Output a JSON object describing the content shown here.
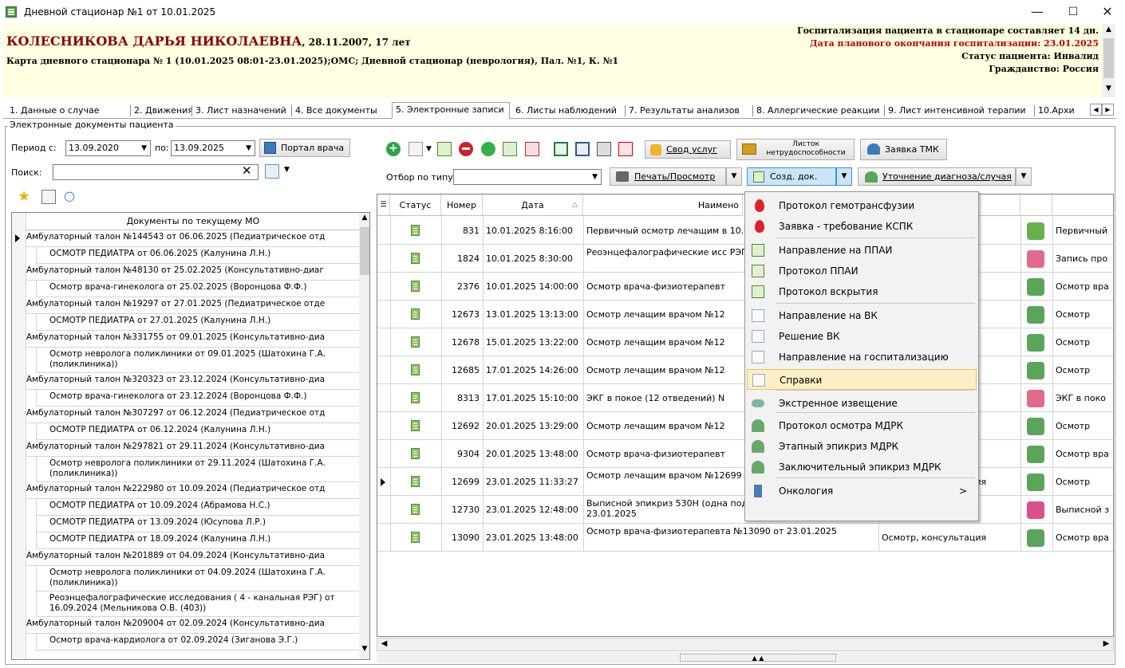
{
  "window": {
    "title": "Дневной стационар №1 от 10.01.2025",
    "minimize": "—",
    "maximize": "☐",
    "close": "✕"
  },
  "patient": {
    "name": "КОЛЕСНИКОВА ДАРЬЯ НИКОЛАЕВНА",
    "dob": ", 28.11.2007, 17 лет",
    "card": "Карта дневного стационара  № 1 (10.01.2025 08:01-23.01.2025);ОМС; Дневной стационар (неврология), Пал. №1, К. №1",
    "info1": "Госпитализация пациента в стационаре составляет 14 дн.",
    "info2": "Дата планового окончания госпитализации: 23.01.2025",
    "info3": "Статус пациента: Инвалид",
    "info4": "Гражданство: Россия"
  },
  "tabs": [
    "1. Данные о случае",
    "2. Движения",
    "3. Лист назначений",
    "4. Все документы",
    "5. Электронные записи",
    "6. Листы наблюдений",
    "7. Результаты анализов",
    "8. Аллергические реакции",
    "9. Лист интенсивной терапии",
    "10.Архи"
  ],
  "group_label": "Электронные документы пациента",
  "left": {
    "period_from_label": "Период с:",
    "period_from": "13.09.2020",
    "period_to_label": "по:",
    "period_to": "13.09.2025",
    "portal_button": "Портал врача",
    "search_label": "Поиск:",
    "search_value": "",
    "clear": "✕",
    "header": "Документы по текущему МО",
    "rows": [
      {
        "t": "Амбулаторный талон №144543 от 06.06.2025 (Педиатрическое отд",
        "c": false,
        "h": 1,
        "cur": true
      },
      {
        "t": "ОСМОТР ПЕДИАТРА от 06.06.2025 (Калунина Л.Н.)",
        "c": true,
        "h": 1
      },
      {
        "t": "Амбулаторный талон №48130 от 25.02.2025 (Консультативно-диаг",
        "c": false,
        "h": 1
      },
      {
        "t": "Осмотр врача-гинеколога от 25.02.2025 (Воронцова Ф.Ф.)",
        "c": true,
        "h": 1
      },
      {
        "t": "Амбулаторный талон №19297 от 27.01.2025 (Педиатрическое отде",
        "c": false,
        "h": 1
      },
      {
        "t": "ОСМОТР ПЕДИАТРА от 27.01.2025 (Калунина Л.Н.)",
        "c": true,
        "h": 1
      },
      {
        "t": "Амбулаторный талон №331755 от 09.01.2025 (Консультативно-диа",
        "c": false,
        "h": 1
      },
      {
        "t": "Осмотр невролога поликлиники от 09.01.2025 (Шатохина Г.А. (поликлиника))",
        "c": true,
        "h": 2
      },
      {
        "t": "Амбулаторный талон №320323 от 23.12.2024 (Консультативно-диа",
        "c": false,
        "h": 1
      },
      {
        "t": "Осмотр врача-гинеколога от 23.12.2024 (Воронцова Ф.Ф.)",
        "c": true,
        "h": 1
      },
      {
        "t": "Амбулаторный талон №307297 от 06.12.2024 (Педиатрическое отд",
        "c": false,
        "h": 1
      },
      {
        "t": "ОСМОТР ПЕДИАТРА от 06.12.2024 (Калунина Л.Н.)",
        "c": true,
        "h": 1
      },
      {
        "t": "Амбулаторный талон №297821 от 29.11.2024 (Консультативно-диа",
        "c": false,
        "h": 1
      },
      {
        "t": "Осмотр невролога поликлиники от 29.11.2024 (Шатохина Г.А. (поликлиника))",
        "c": true,
        "h": 2
      },
      {
        "t": "Амбулаторный талон №222980 от 10.09.2024 (Педиатрическое отд",
        "c": false,
        "h": 1
      },
      {
        "t": "ОСМОТР ПЕДИАТРА от 10.09.2024 (Абрамова Н.С.)",
        "c": true,
        "h": 1
      },
      {
        "t": "ОСМОТР ПЕДИАТРА от 13.09.2024 (Юсупова Л.Р.)",
        "c": true,
        "h": 1
      },
      {
        "t": "ОСМОТР ПЕДИАТРА от 18.09.2024 (Калунина Л.Н.)",
        "c": true,
        "h": 1
      },
      {
        "t": "Амбулаторный талон №201889 от 04.09.2024 (Консультативно-диа",
        "c": false,
        "h": 1
      },
      {
        "t": "Осмотр невролога поликлиники от 04.09.2024 (Шатохина Г.А. (поликлиника))",
        "c": true,
        "h": 2
      },
      {
        "t": "Реоэнцефалографические исследования ( 4 - канальная РЭГ) от 16.09.2024 (Мельникова О.В. (403))",
        "c": true,
        "h": 2
      },
      {
        "t": "Амбулаторный талон №209004 от 02.09.2024 (Консультативно-диа",
        "c": false,
        "h": 1
      },
      {
        "t": "Осмотр врача-кардиолога от 02.09.2024 (Зиганова Э.Г.)",
        "c": true,
        "h": 1
      }
    ]
  },
  "toolbar": {
    "svod": "Свод услуг",
    "listok_top": "Листок",
    "listok_bottom": "нетрудоспособности",
    "tmk": "Заявка ТМК",
    "filter_label": "Отбор по типу:",
    "filter_value": "",
    "print": "Печать/Просмотр",
    "create": "Созд. док.",
    "refine": "Уточнение диагноза/случая"
  },
  "grid": {
    "headers": [
      "Статус",
      "Номер",
      "Дата",
      "Наимено"
    ],
    "rows": [
      {
        "num": "831",
        "date": "10.01.2025 8:16:00",
        "name": "Первичный осмотр лечащим в 10.01.2025",
        "type": "",
        "rtext": "Первичный",
        "ic": "#6ab04c"
      },
      {
        "num": "1824",
        "date": "10.01.2025 8:30:00",
        "name": "Реоэнцефалографические исс РЭГ) №1824 от 10.01.2025",
        "type": "ания",
        "rtext": "Запись про",
        "ic": "#e06a8a"
      },
      {
        "num": "2376",
        "date": "10.01.2025 14:00:00",
        "name": "Осмотр врача-физиотерапевт",
        "type": "ия",
        "rtext": "Осмотр вра",
        "ic": "#5aa55a"
      },
      {
        "num": "12673",
        "date": "13.01.2025 13:13:00",
        "name": "Осмотр лечащим врачом №12",
        "type": "ия",
        "rtext": "Осмотр",
        "ic": "#5aa55a"
      },
      {
        "num": "12678",
        "date": "15.01.2025 13:22:00",
        "name": "Осмотр лечащим врачом №12",
        "type": "ия",
        "rtext": "Осмотр",
        "ic": "#5aa55a"
      },
      {
        "num": "12685",
        "date": "17.01.2025 14:26:00",
        "name": "Осмотр лечащим врачом №12",
        "type": "ия",
        "rtext": "Осмотр",
        "ic": "#5aa55a"
      },
      {
        "num": "8313",
        "date": "17.01.2025 15:10:00",
        "name": "ЭКГ в покое (12 отведений) N",
        "type": "ания",
        "rtext": "ЭКГ в поко",
        "ic": "#e06a8a"
      },
      {
        "num": "12692",
        "date": "20.01.2025 13:29:00",
        "name": "Осмотр лечащим врачом №12",
        "type": "ия",
        "rtext": "Осмотр",
        "ic": "#5aa55a"
      },
      {
        "num": "9304",
        "date": "20.01.2025 13:48:00",
        "name": "Осмотр врача-физиотерапевт",
        "type": "ия",
        "rtext": "Осмотр вра",
        "ic": "#5aa55a"
      },
      {
        "num": "12699",
        "date": "23.01.2025 11:33:27",
        "name": "Осмотр лечащим врачом №12699 от 23.01.2025",
        "type": "Осмотр, консультация",
        "rtext": "Осмотр",
        "ic": "#5aa55a"
      },
      {
        "num": "12730",
        "date": "23.01.2025 12:48:00",
        "name": "Выписной эпикриз 530Н (одна подпись) №12730 от 23.01.2025",
        "type": "Выписка",
        "rtext": "Выписной з",
        "ic": "#d9508a"
      },
      {
        "num": "13090",
        "date": "23.01.2025 13:48:00",
        "name": "Осмотр врача-физиотерапевта №13090 от 23.01.2025",
        "type": "Осмотр, консультация",
        "rtext": "Осмотр вра",
        "ic": "#5aa55a"
      }
    ]
  },
  "menu": [
    {
      "label": "Протокол гемотрансфузии",
      "ic": "drop"
    },
    {
      "label": "Заявка - требование КСПК",
      "ic": "drop"
    },
    {
      "label": "Направление на ППАИ",
      "ic": "doc"
    },
    {
      "label": "Протокол ППАИ",
      "ic": "doc"
    },
    {
      "label": "Протокол вскрытия",
      "ic": "doc"
    },
    {
      "label": "Направление на ВК",
      "ic": "page"
    },
    {
      "label": "Решение ВК",
      "ic": "page"
    },
    {
      "label": "Направление на госпитализацию",
      "ic": "page"
    },
    {
      "label": "Справки",
      "ic": "page"
    },
    {
      "label": "Экстренное извещение",
      "ic": "pill"
    },
    {
      "label": "Протокол осмотра МДРК",
      "ic": "people"
    },
    {
      "label": "Этапный эпикриз МДРК",
      "ic": "people"
    },
    {
      "label": "Заключительный эпикриз МДРК",
      "ic": "people"
    },
    {
      "label": "Онкология",
      "ic": "onco"
    }
  ],
  "menu_arrow": ">"
}
